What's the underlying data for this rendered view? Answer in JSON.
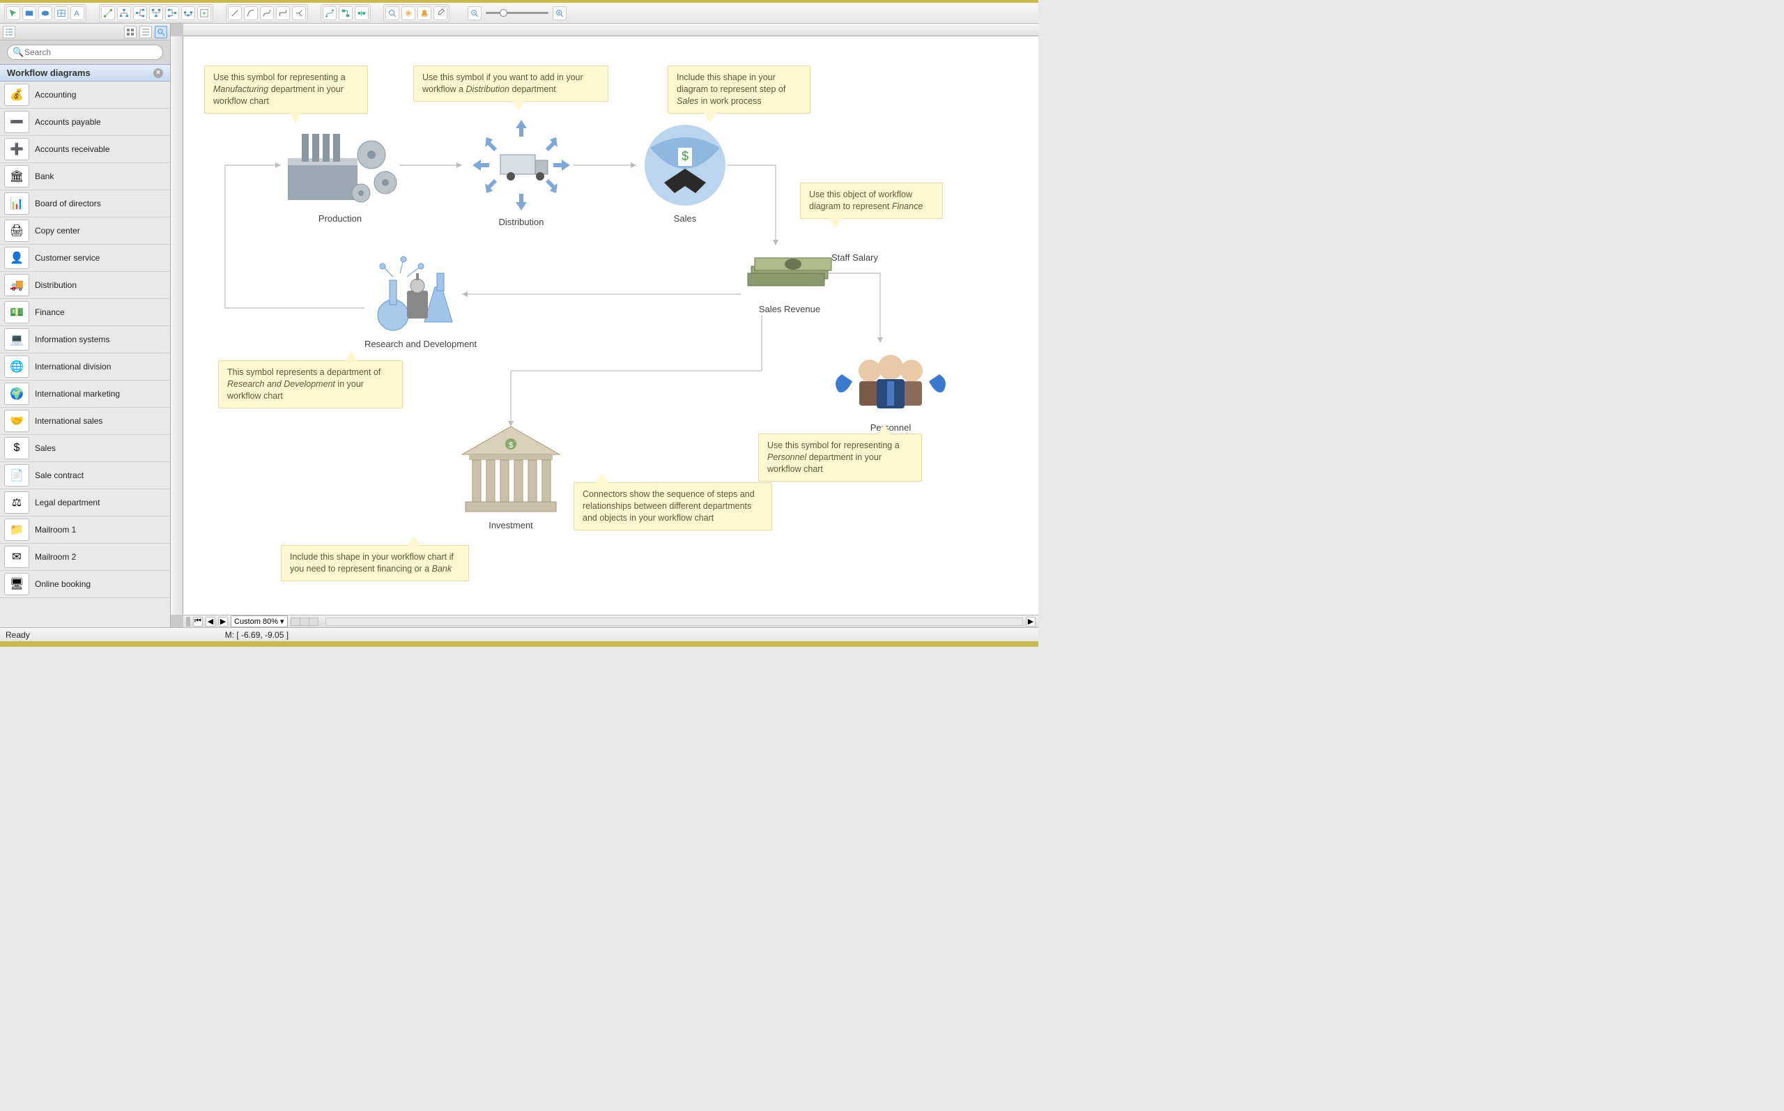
{
  "toolbar": {
    "groups": [
      [
        "pointer",
        "rect",
        "ellipse",
        "table",
        "text"
      ],
      [
        "segment",
        "add-node",
        "align-left",
        "align-center",
        "align-right",
        "distribute",
        "group"
      ],
      [
        "line",
        "curve",
        "orthogonal",
        "split",
        "merge"
      ],
      [
        "link-a",
        "link-b",
        "link-c"
      ],
      [
        "zoom-in",
        "pan",
        "stamp",
        "eyedropper"
      ]
    ],
    "zoom_out": "zoom-out",
    "zoom_in": "zoom-in"
  },
  "sidebar": {
    "search_placeholder": "Search",
    "library_title": "Workflow diagrams",
    "items": [
      {
        "label": "Accounting",
        "glyph": "💰"
      },
      {
        "label": "Accounts payable",
        "glyph": "➖"
      },
      {
        "label": "Accounts receivable",
        "glyph": "➕"
      },
      {
        "label": "Bank",
        "glyph": "🏛"
      },
      {
        "label": "Board of directors",
        "glyph": "📊"
      },
      {
        "label": "Copy center",
        "glyph": "🖨"
      },
      {
        "label": "Customer service",
        "glyph": "👤"
      },
      {
        "label": "Distribution",
        "glyph": "🚚"
      },
      {
        "label": "Finance",
        "glyph": "💵"
      },
      {
        "label": "Information systems",
        "glyph": "💻"
      },
      {
        "label": "International division",
        "glyph": "🌐"
      },
      {
        "label": "International marketing",
        "glyph": "🌍"
      },
      {
        "label": "International sales",
        "glyph": "🤝"
      },
      {
        "label": "Sales",
        "glyph": "$"
      },
      {
        "label": "Sale contract",
        "glyph": "📄"
      },
      {
        "label": "Legal department",
        "glyph": "⚖"
      },
      {
        "label": "Mailroom 1",
        "glyph": "📁"
      },
      {
        "label": "Mailroom 2",
        "glyph": "✉"
      },
      {
        "label": "Online booking",
        "glyph": "🖥"
      }
    ]
  },
  "diagram": {
    "nodes": {
      "production": {
        "label": "Production"
      },
      "distribution": {
        "label": "Distribution"
      },
      "sales": {
        "label": "Sales"
      },
      "rnd": {
        "label": "Research and Development"
      },
      "staff_salary": {
        "label": "Staff Salary"
      },
      "sales_revenue": {
        "label": "Sales Revenue"
      },
      "personnel": {
        "label": "Personnel"
      },
      "investment": {
        "label": "Investment"
      }
    },
    "callouts": {
      "production": "Use this symbol for representing a <em>Manufacturing</em> department in your workflow chart",
      "distribution": "Use this symbol if you want to add in your workflow a <em>Distribution</em> department",
      "sales": "Include this shape in your diagram to represent step of <em>Sales</em> in work process",
      "finance": "Use this object of workflow diagram to represent <em>Finance</em>",
      "rnd": "This symbol represents a department of <em>Research and Development</em> in your workflow chart",
      "investment": "Include this shape in your workflow chart if you need to represent financing or a <em>Bank</em>",
      "connectors": "Connectors show the sequence of steps and relationships between different departments and objects in your workflow chart",
      "personnel": "Use this symbol for representing a <em>Personnel</em> department in your workflow chart"
    }
  },
  "bottombar": {
    "zoom_label": "Custom 80%"
  },
  "status": {
    "ready": "Ready",
    "coords": "M: [ -6.69, -9.05 ]"
  }
}
